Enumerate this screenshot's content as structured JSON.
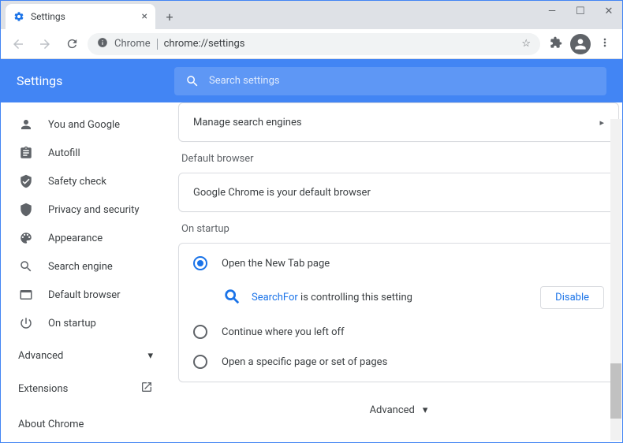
{
  "tab": {
    "title": "Settings"
  },
  "omnibox": {
    "product": "Chrome",
    "url": "chrome://settings"
  },
  "header": {
    "title": "Settings"
  },
  "search": {
    "placeholder": "Search settings"
  },
  "sidebar": {
    "items": [
      {
        "label": "You and Google"
      },
      {
        "label": "Autofill"
      },
      {
        "label": "Safety check"
      },
      {
        "label": "Privacy and security"
      },
      {
        "label": "Appearance"
      },
      {
        "label": "Search engine"
      },
      {
        "label": "Default browser"
      },
      {
        "label": "On startup"
      }
    ],
    "advanced": "Advanced",
    "extensions": "Extensions",
    "about": "About Chrome"
  },
  "panel": {
    "manage_search": "Manage search engines",
    "default_browser_label": "Default browser",
    "default_browser_text": "Google Chrome is your default browser",
    "on_startup_label": "On startup",
    "opt_newtab": "Open the New Tab page",
    "ext_name": "SearchFor",
    "ext_controlling": " is controlling this setting",
    "disable": "Disable",
    "opt_continue": "Continue where you left off",
    "opt_specific": "Open a specific page or set of pages",
    "bottom_advanced": "Advanced"
  }
}
